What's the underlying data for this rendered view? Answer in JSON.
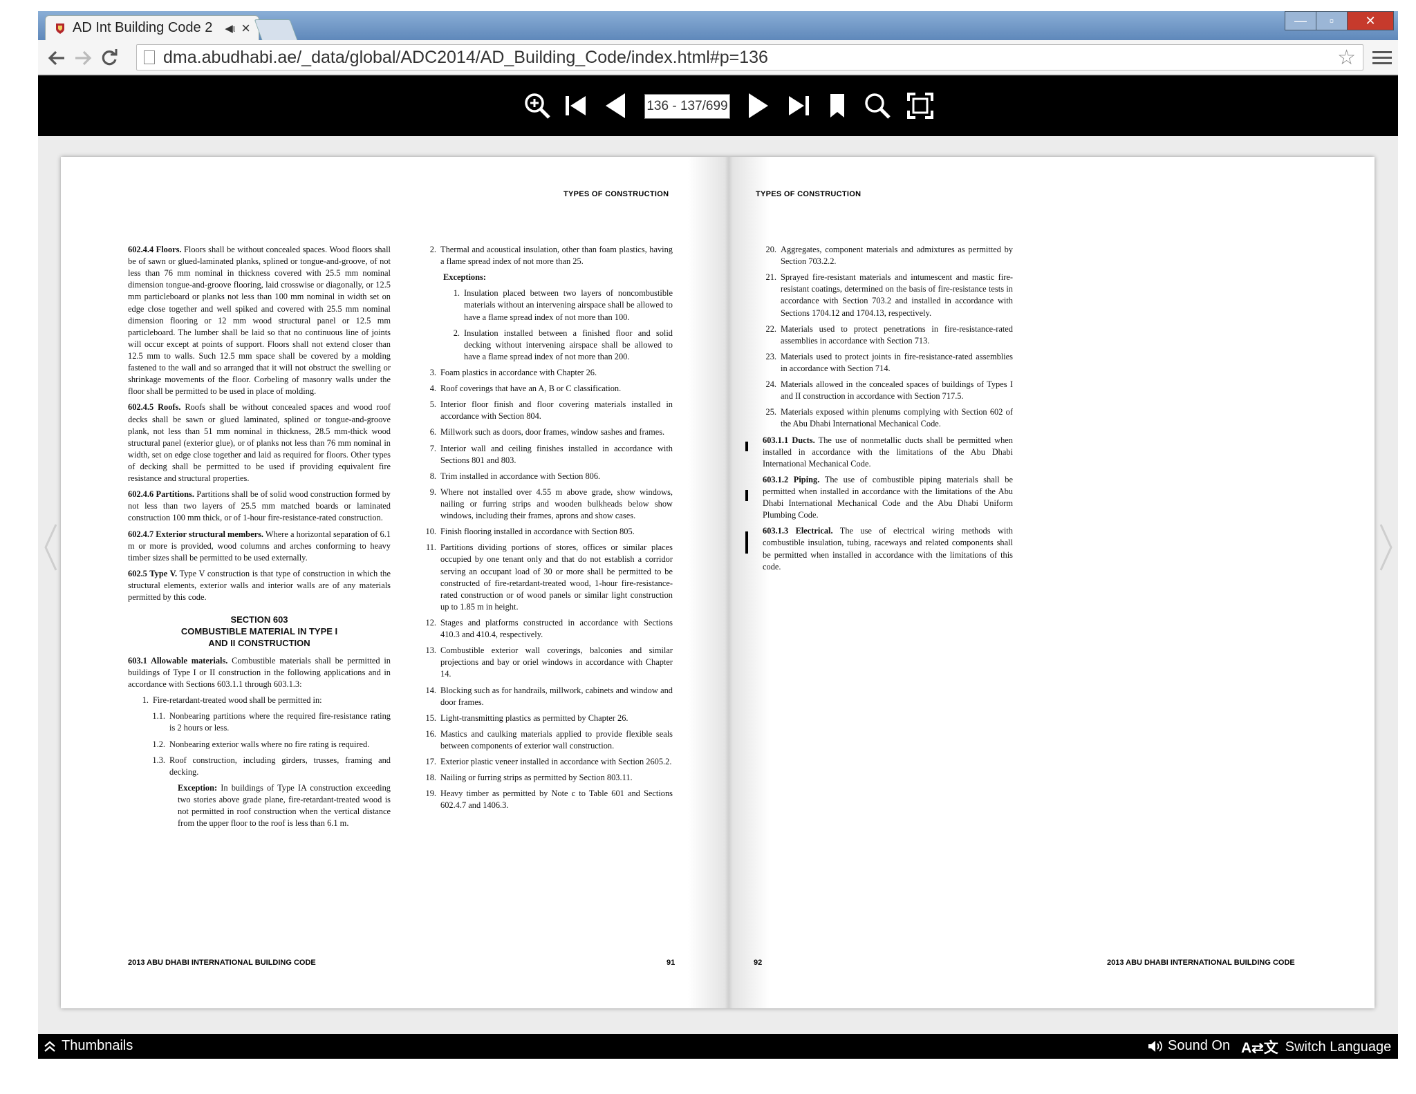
{
  "browser": {
    "tab_title": "AD Int Building Code 2",
    "url": "dma.abudhabi.ae/_data/global/ADC2014/AD_Building_Code/index.html#p=136"
  },
  "viewer": {
    "page_indicator": "136 - 137/699"
  },
  "footer_bar": {
    "thumbnails_label": "Thumbnails",
    "sound_label": "Sound On",
    "lang_icon_text": "A⇄文",
    "switch_language_label": "Switch Language"
  },
  "left_page": {
    "running_head": "TYPES OF CONSTRUCTION",
    "footer_title": "2013 ABU DHABI INTERNATIONAL BUILDING CODE",
    "page_number": "91",
    "col1": {
      "p1_head": "602.4.4 Floors.",
      "p1_text": " Floors shall be without concealed spaces. Wood floors shall be of sawn or glued-laminated planks, splined or tongue-and-groove, of not less than 76 mm nominal in thickness covered with 25.5 mm nominal dimension tongue-and-groove flooring, laid crosswise or diagonally, or 12.5 mm particleboard or planks not less than 100 mm nominal in width set on edge close together and well spiked and covered with 25.5 mm nominal dimension flooring or 12 mm wood structural panel or 12.5 mm particleboard. The lumber shall be laid so that no continuous line of joints will occur except at points of support. Floors shall not extend closer than 12.5 mm to walls. Such 12.5 mm space shall be covered by a molding fastened to the wall and so arranged that it will not obstruct the swelling or shrinkage movements of the floor. Corbeling of masonry walls under the floor shall be permitted to be used in place of molding.",
      "p2_head": "602.4.5 Roofs.",
      "p2_text": " Roofs shall be without concealed spaces and wood roof decks shall be sawn or glued laminated, splined or tongue-and-groove plank, not less than 51 mm nominal in thickness, 28.5 mm-thick wood structural panel (exterior glue), or of planks not less than 76 mm nominal in width, set on edge close together and laid as required for floors. Other types of decking shall be permitted to be used if providing equivalent fire resistance and structural properties.",
      "p3_head": "602.4.6 Partitions.",
      "p3_text": " Partitions shall be of solid wood construction formed by not less than two layers of 25.5 mm matched boards or laminated construction 100 mm thick, or of 1-hour fire-resistance-rated construction.",
      "p4_head": "602.4.7 Exterior structural members.",
      "p4_text": " Where a horizontal separation of 6.1 m or more is provided, wood columns and arches conforming to heavy timber sizes shall be permitted to be used externally.",
      "p5_head": "602.5 Type V.",
      "p5_text": " Type V construction is that type of construction in which the structural elements, exterior walls and interior walls are of any materials permitted by this code.",
      "section_line1": "SECTION 603",
      "section_line2": "COMBUSTIBLE MATERIAL IN TYPE I",
      "section_line3": "AND II CONSTRUCTION",
      "p6_head": "603.1 Allowable materials.",
      "p6_text": " Combustible materials shall be permitted in buildings of Type I or II construction in the following applications and in accordance with Sections 603.1.1 through 603.1.3:",
      "i1_num": "1.",
      "i1_text": "Fire-retardant-treated wood shall be permitted in:",
      "i11_num": "1.1.",
      "i11_text": "Nonbearing partitions where the required fire-resistance rating is 2 hours or less.",
      "i12_num": "1.2.",
      "i12_text": "Nonbearing exterior walls where no fire rating is required.",
      "i13_num": "1.3.",
      "i13_text": "Roof construction, including girders, trusses, framing and decking.",
      "exc_head": "Exception:",
      "exc_text": " In buildings of Type IA construction exceeding two stories above grade plane, fire-retardant-treated wood is not permitted in roof construction when the vertical distance from the upper floor to the roof is less than 6.1 m."
    },
    "col2": {
      "i2_num": "2.",
      "i2_text": "Thermal and acoustical insulation, other than foam plastics, having a flame spread index of not more than 25.",
      "exceptions_head": "Exceptions:",
      "e1_num": "1.",
      "e1_text": "Insulation placed between two layers of noncombustible materials without an intervening airspace shall be allowed to have a flame spread index of not more than 100.",
      "e2_num": "2.",
      "e2_text": "Insulation installed between a finished floor and solid decking without intervening airspace shall be allowed to have a flame spread index of not more than 200.",
      "i3_num": "3.",
      "i3_text": "Foam plastics in accordance with Chapter 26.",
      "i4_num": "4.",
      "i4_text": "Roof coverings that have an A, B or C classification.",
      "i5_num": "5.",
      "i5_text": "Interior floor finish and floor covering materials installed in accordance with Section 804.",
      "i6_num": "6.",
      "i6_text": "Millwork such as doors, door frames, window sashes and frames.",
      "i7_num": "7.",
      "i7_text": "Interior wall and ceiling finishes installed in accordance with Sections 801 and 803.",
      "i8_num": "8.",
      "i8_text": "Trim installed in accordance with Section 806.",
      "i9_num": "9.",
      "i9_text": "Where not installed over 4.55 m above grade, show windows, nailing or furring strips and wooden bulkheads below show windows, including their frames, aprons and show cases.",
      "i10_num": "10.",
      "i10_text": "Finish flooring installed in accordance with Section 805.",
      "i11_num": "11.",
      "i11_text": "Partitions dividing portions of stores, offices or similar places occupied by one tenant only and that do not establish a corridor serving an occupant load of 30 or more shall be permitted to be constructed of fire-retardant-treated wood, 1-hour fire-resistance-rated construction or of wood panels or similar light construction up to 1.85 m in height.",
      "i12_num": "12.",
      "i12_text": "Stages and platforms constructed in accordance with Sections 410.3 and 410.4, respectively.",
      "i13_num": "13.",
      "i13_text": "Combustible exterior wall coverings, balconies and similar projections and bay or oriel windows in accordance with Chapter 14.",
      "i14_num": "14.",
      "i14_text": "Blocking such as for handrails, millwork, cabinets and window and door frames.",
      "i15_num": "15.",
      "i15_text": "Light-transmitting plastics as permitted by Chapter 26.",
      "i16_num": "16.",
      "i16_text": "Mastics and caulking materials applied to provide flexible seals between components of exterior wall construction.",
      "i17_num": "17.",
      "i17_text": "Exterior plastic veneer installed in accordance with Section 2605.2.",
      "i18_num": "18.",
      "i18_text": "Nailing or furring strips as permitted by Section 803.11.",
      "i19_num": "19.",
      "i19_text": "Heavy timber as permitted by Note c to Table 601 and Sections 602.4.7 and 1406.3."
    }
  },
  "right_page": {
    "running_head": "TYPES OF CONSTRUCTION",
    "footer_title": "2013 ABU DHABI INTERNATIONAL BUILDING CODE",
    "page_number": "92",
    "col1": {
      "i20_num": "20.",
      "i20_text": "Aggregates, component materials and admixtures as permitted by Section 703.2.2.",
      "i21_num": "21.",
      "i21_text": "Sprayed fire-resistant materials and intumescent and mastic fire-resistant coatings, determined on the basis of fire-resistance tests in accordance with Section 703.2 and installed in accordance with Sections 1704.12 and 1704.13, respectively.",
      "i22_num": "22.",
      "i22_text": "Materials used to protect penetrations in fire-resistance-rated assemblies in accordance with Section 713.",
      "i23_num": "23.",
      "i23_text": "Materials used to protect joints in fire-resistance-rated assemblies in accordance with Section 714.",
      "i24_num": "24.",
      "i24_text": "Materials allowed in the concealed spaces of buildings of Types I and II construction in accordance with Section 717.5.",
      "i25_num": "25.",
      "i25_text": "Materials exposed within plenums complying with Section 602 of the Abu Dhabi International Mechanical Code.",
      "p1_head": "603.1.1 Ducts.",
      "p1_text": " The use of nonmetallic ducts shall be permitted when installed in accordance with the limitations of the Abu Dhabi International Mechanical Code.",
      "p2_head": "603.1.2 Piping.",
      "p2_text": " The use of combustible piping materials shall be permitted when installed in accordance with the limitations of the Abu Dhabi International Mechanical Code and the Abu Dhabi Uniform Plumbing Code.",
      "p3_head": "603.1.3 Electrical.",
      "p3_text": " The use of electrical wiring methods with combustible insulation, tubing, raceways and related components shall be permitted when installed in accordance with the limitations of this code."
    }
  }
}
